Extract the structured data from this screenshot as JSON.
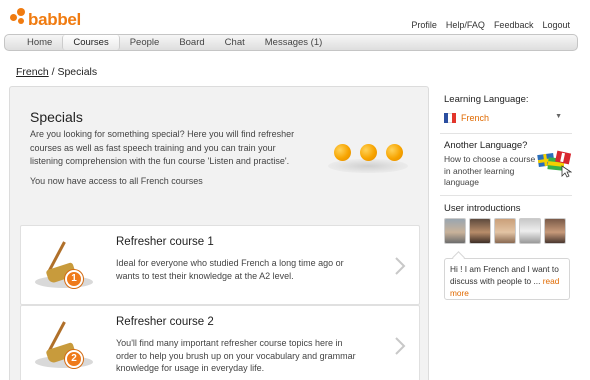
{
  "brand": {
    "name": "babbel",
    "color": "#f07b10"
  },
  "top_links": [
    "Profile",
    "Help/FAQ",
    "Feedback",
    "Logout"
  ],
  "nav": {
    "tabs": [
      "Home",
      "Courses",
      "People",
      "Board",
      "Chat",
      "Messages (1)"
    ],
    "active": "Courses"
  },
  "breadcrumb": {
    "link": "French",
    "separator": " / ",
    "current": "Specials"
  },
  "specials": {
    "title": "Specials",
    "description": "Are you looking for something special? Here you will find refresher courses as well as fast speech training and you can train your listening comprehension with the fun course 'Listen and practise'.",
    "access_note": "You now have access to all French courses"
  },
  "courses": [
    {
      "number": "1",
      "title": "Refresher course 1",
      "description": "Ideal for everyone who studied French a long time ago or wants to test their knowledge at the A2 level.",
      "icon": "broom-icon"
    },
    {
      "number": "2",
      "title": "Refresher course 2",
      "description": "You'll find many important refresher course topics here in order to help you brush up on your vocabulary and grammar knowledge for usage in everyday life.",
      "icon": "broom-icon"
    }
  ],
  "sidebar": {
    "learning_language_label": "Learning Language:",
    "learning_language_value": "French",
    "another_language_label": "Another Language?",
    "another_language_desc": "How to choose a course in another learning language",
    "user_intro_label": "User introductions",
    "intro_bubble_text": "Hi ! I am French and I want to discuss with people to ... ",
    "intro_bubble_more": "read more"
  },
  "colors": {
    "accent": "#e06a00",
    "ball": "#f7a400",
    "badge": "#ef7a1a"
  }
}
